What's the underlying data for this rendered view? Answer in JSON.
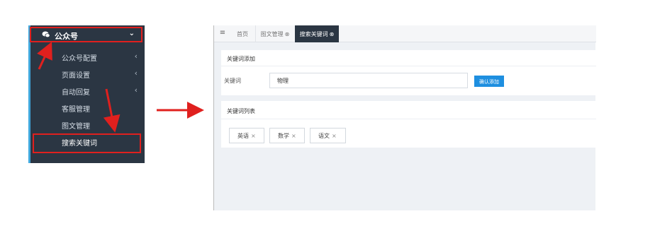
{
  "sidebar": {
    "header": {
      "label": "公众号",
      "icon": "wechat-icon",
      "chevron": "⌄"
    },
    "items": [
      {
        "label": "公众号配置",
        "has_submenu": true,
        "chevron": "‹"
      },
      {
        "label": "页面设置",
        "has_submenu": true,
        "chevron": "‹"
      },
      {
        "label": "自动回复",
        "has_submenu": true,
        "chevron": "‹"
      },
      {
        "label": "客服管理",
        "has_submenu": false
      },
      {
        "label": "图文管理",
        "has_submenu": false
      },
      {
        "label": "搜索关键词",
        "has_submenu": false,
        "active": true
      }
    ]
  },
  "tabs": {
    "menu_icon": "≡",
    "items": [
      {
        "label": "首页",
        "closable": false
      },
      {
        "label": "图文管理",
        "closable": true,
        "close_glyph": "⊗"
      },
      {
        "label": "搜索关键词",
        "closable": true,
        "close_glyph": "⊗",
        "active": true
      }
    ]
  },
  "add_panel": {
    "title": "关键词添加",
    "field_label": "关键词",
    "field_value": "物理",
    "confirm_label": "确认添加"
  },
  "list_panel": {
    "title": "关键词列表",
    "remove_glyph": "×",
    "tags": [
      {
        "label": "英语"
      },
      {
        "label": "数学"
      },
      {
        "label": "语文"
      }
    ]
  },
  "colors": {
    "sidebar_bg": "#2b3643",
    "accent_blue": "#1e8fe0",
    "annotation_red": "#e0201e"
  }
}
